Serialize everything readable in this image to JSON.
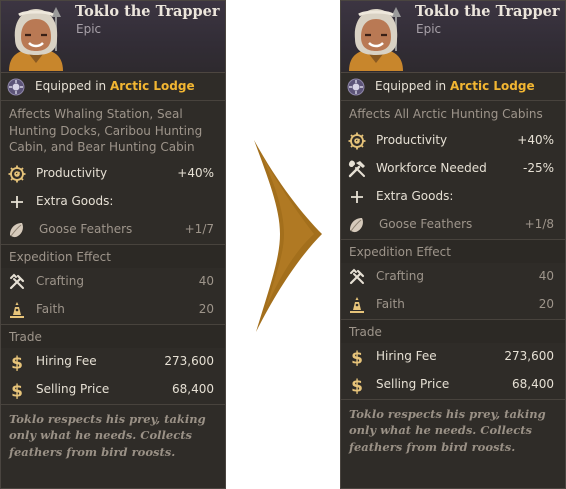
{
  "before": {
    "name": "Toklo the Trapper",
    "rarity": "Epic",
    "equipped_prefix": "Equipped in ",
    "equipped_location": "Arctic Lodge",
    "affects": "Affects Whaling Station, Seal Hunting Docks, Caribou Hunting Cabin, and Bear Hunting Cabin",
    "stats": [
      {
        "label": "Productivity",
        "value": "+40%",
        "icon": "gear-icon"
      }
    ],
    "extra_goods_label": "Extra Goods:",
    "extra_goods": [
      {
        "label": "Goose Feathers",
        "value": "+1/7",
        "icon": "feather-icon"
      }
    ],
    "expedition_title": "Expedition Effect",
    "expedition": [
      {
        "label": "Crafting",
        "value": "40",
        "icon": "crafting-tools-icon"
      },
      {
        "label": "Faith",
        "value": "20",
        "icon": "faith-icon"
      }
    ],
    "trade_title": "Trade",
    "trade": [
      {
        "label": "Hiring Fee",
        "value": "273,600",
        "icon": "dollar-icon"
      },
      {
        "label": "Selling Price",
        "value": "68,400",
        "icon": "dollar-icon"
      }
    ],
    "flavor": "Toklo respects his prey, taking only what he needs. Collects feathers from bird roosts."
  },
  "after": {
    "name": "Toklo the Trapper",
    "rarity": "Epic",
    "equipped_prefix": "Equipped in ",
    "equipped_location": "Arctic Lodge",
    "affects": "Affects All Arctic Hunting Cabins",
    "stats": [
      {
        "label": "Productivity",
        "value": "+40%",
        "icon": "gear-icon"
      },
      {
        "label": "Workforce Needed",
        "value": "-25%",
        "icon": "hammer-wrench-icon"
      }
    ],
    "extra_goods_label": "Extra Goods:",
    "extra_goods": [
      {
        "label": "Goose Feathers",
        "value": "+1/8",
        "icon": "feather-icon"
      }
    ],
    "expedition_title": "Expedition Effect",
    "expedition": [
      {
        "label": "Crafting",
        "value": "40",
        "icon": "crafting-tools-icon"
      },
      {
        "label": "Faith",
        "value": "20",
        "icon": "faith-icon"
      }
    ],
    "trade_title": "Trade",
    "trade": [
      {
        "label": "Hiring Fee",
        "value": "273,600",
        "icon": "dollar-icon"
      },
      {
        "label": "Selling Price",
        "value": "68,400",
        "icon": "dollar-icon"
      }
    ],
    "flavor": "Toklo respects his prey, taking only what he needs. Collects feathers from bird roosts."
  },
  "colors": {
    "accent_location": "#f2b632",
    "icon_gold": "#e7c47a",
    "arrow": "#a36f1c",
    "panel_bg": "#2f2c28"
  }
}
